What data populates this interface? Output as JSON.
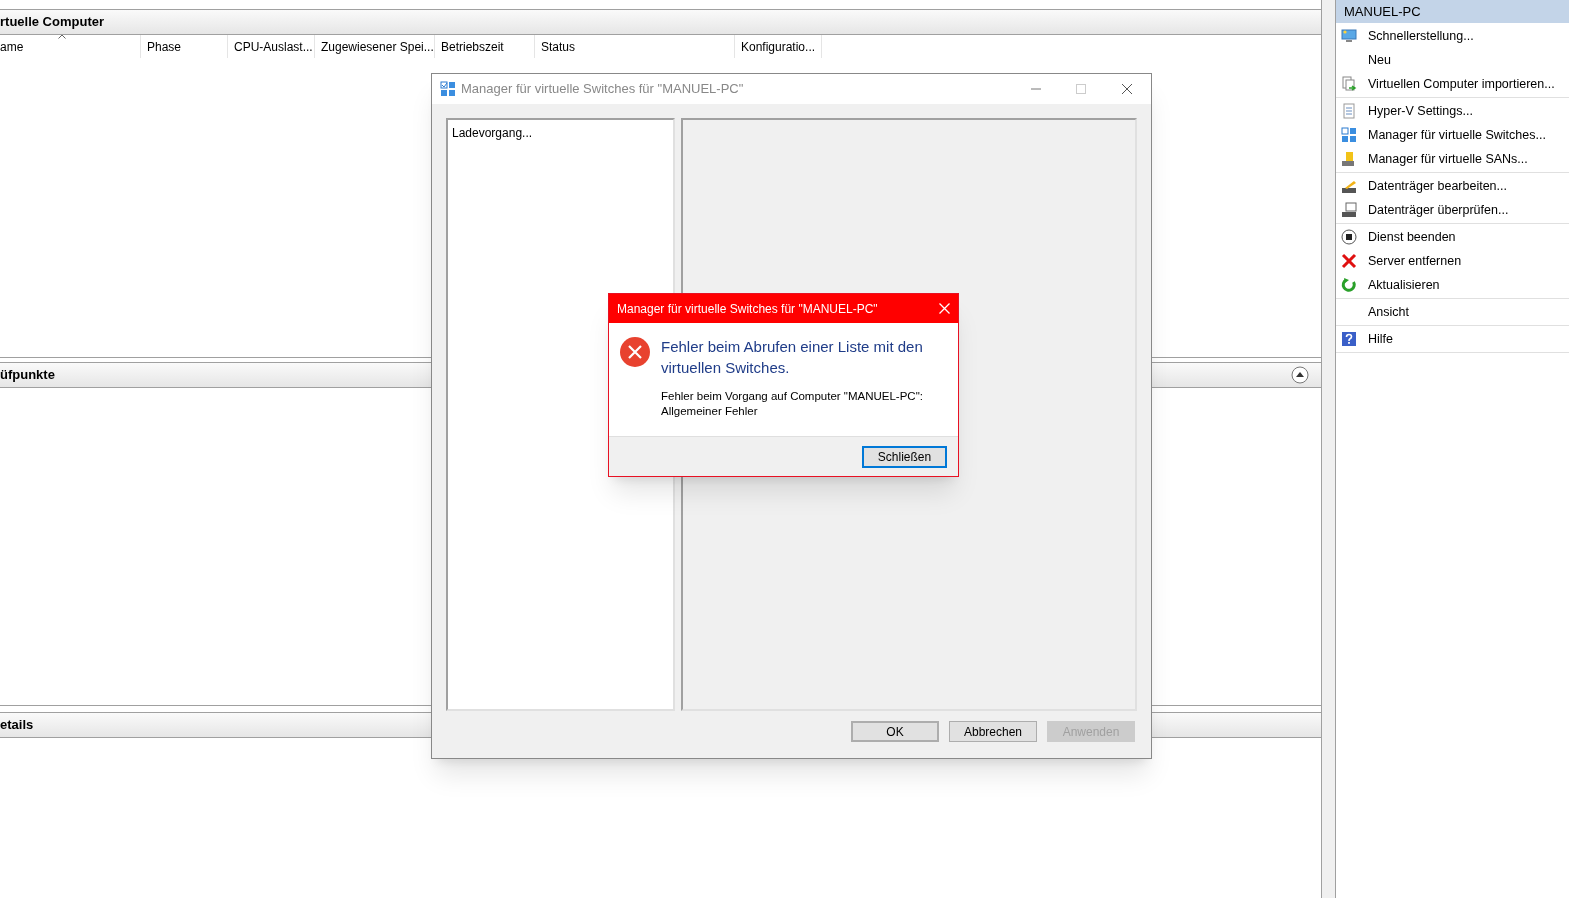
{
  "vm_panel": {
    "title": "rtuelle Computer",
    "columns": [
      {
        "label": "ame",
        "sorted": true
      },
      {
        "label": "Phase",
        "sorted": false
      },
      {
        "label": "CPU-Auslast...",
        "sorted": false
      },
      {
        "label": "Zugewiesener Spei...",
        "sorted": false
      },
      {
        "label": "Betriebszeit",
        "sorted": false
      },
      {
        "label": "Status",
        "sorted": false
      },
      {
        "label": "Konfiguratio...",
        "sorted": false
      }
    ]
  },
  "checkpoints_panel": {
    "title": "üfpunkte",
    "expanded": true
  },
  "details_panel": {
    "title": "etails"
  },
  "actions": {
    "title": "MANUEL-PC",
    "groups": [
      [
        {
          "label": "Schnellerstellung...",
          "kind": "monitor"
        },
        {
          "label": "Neu",
          "kind": "plain"
        },
        {
          "label": "Virtuellen Computer importieren...",
          "kind": "import"
        }
      ],
      [
        {
          "label": "Hyper-V Settings...",
          "kind": "settings"
        },
        {
          "label": "Manager für virtuelle Switches...",
          "kind": "switches"
        },
        {
          "label": "Manager für virtuelle SANs...",
          "kind": "san"
        }
      ],
      [
        {
          "label": "Datenträger bearbeiten...",
          "kind": "edit"
        },
        {
          "label": "Datenträger überprüfen...",
          "kind": "inspect"
        }
      ],
      [
        {
          "label": "Dienst beenden",
          "kind": "stop"
        },
        {
          "label": "Server entfernen",
          "kind": "remove"
        },
        {
          "label": "Aktualisieren",
          "kind": "refresh"
        }
      ],
      [
        {
          "label": "Ansicht",
          "kind": "plain"
        }
      ],
      [
        {
          "label": "Hilfe",
          "kind": "help"
        }
      ]
    ]
  },
  "switch_manager": {
    "title": "Manager für virtuelle Switches für \"MANUEL-PC\"",
    "list_text": "Ladevorgang...",
    "buttons": [
      {
        "label": "OK",
        "default": true,
        "disabled": false
      },
      {
        "label": "Abbrechen",
        "default": false,
        "disabled": false
      },
      {
        "label": "Anwenden",
        "default": false,
        "disabled": true
      }
    ]
  },
  "error_dialog": {
    "title": "Manager für virtuelle Switches für \"MANUEL-PC\"",
    "heading": "Fehler beim Abrufen einer Liste mit den virtuellen Switches.",
    "message": "Fehler beim Vorgang auf Computer \"MANUEL-PC\":\nAllgemeiner Fehler",
    "button": "Schließen"
  }
}
